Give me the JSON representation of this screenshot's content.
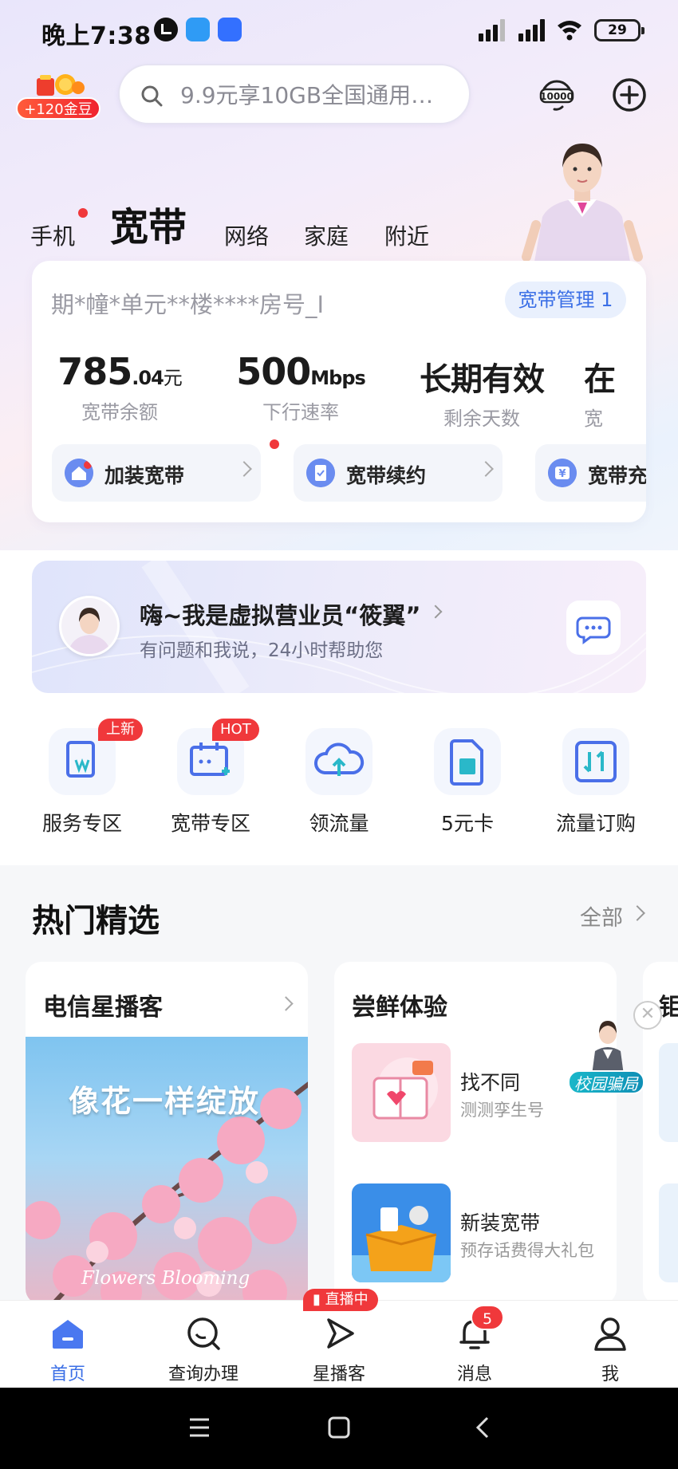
{
  "status_bar": {
    "time": "晚上7:38",
    "battery": "29",
    "icons": [
      "alarm-icon",
      "cloud-icon",
      "chat-app-icon",
      "signal-icon",
      "signal-icon",
      "wifi-icon",
      "battery-icon"
    ]
  },
  "header": {
    "coin_badge": "+120金豆",
    "search_placeholder": "9.9元享10GB全国通用…",
    "service_hotline_icon": "10000-hotline-icon",
    "add_icon": "plus-circle-icon"
  },
  "category_tabs": [
    {
      "label": "手机",
      "active": false,
      "dot": true
    },
    {
      "label": "宽带",
      "active": true,
      "dot": false
    },
    {
      "label": "网络",
      "active": false,
      "dot": false
    },
    {
      "label": "家庭",
      "active": false,
      "dot": false
    },
    {
      "label": "附近",
      "active": false,
      "dot": false
    }
  ],
  "broadband_card": {
    "address": "期*幢*单元**楼****房号_I",
    "manage_label": "宽带管理 1",
    "stats": [
      {
        "value": "785",
        "decimal": ".04",
        "unit": "元",
        "label": "宽带余额"
      },
      {
        "value": "500",
        "decimal": "",
        "unit": "Mbps",
        "label": "下行速率"
      },
      {
        "value": "长期有效",
        "decimal": "",
        "unit": "",
        "label": "剩余天数"
      },
      {
        "value": "在",
        "decimal": "",
        "unit": "",
        "label": "宽"
      }
    ],
    "actions": [
      {
        "label": "加装宽带",
        "icon": "home-add-icon"
      },
      {
        "label": "宽带续约",
        "icon": "contract-icon"
      },
      {
        "label": "宽带充",
        "icon": "yuan-icon"
      }
    ]
  },
  "assistant": {
    "title": "嗨~我是虚拟营业员“筱翼”",
    "subtitle": "有问题和我说，24小时帮助您"
  },
  "services": [
    {
      "label": "服务专区",
      "tag": "上新",
      "icon": "service-doc-icon"
    },
    {
      "label": "宽带专区",
      "tag": "HOT",
      "icon": "broadband-calendar-icon"
    },
    {
      "label": "领流量",
      "tag": "",
      "icon": "cloud-upload-icon"
    },
    {
      "label": "5元卡",
      "tag": "",
      "icon": "sim-card-icon"
    },
    {
      "label": "流量订购",
      "tag": "",
      "icon": "data-order-icon"
    }
  ],
  "featured": {
    "title": "热门精选",
    "more": "全部",
    "cards": [
      {
        "title": "电信星播客",
        "poster_title": "像花一样绽放",
        "poster_sub": "Flowers Blooming"
      },
      {
        "title": "尝鲜体验",
        "items": [
          {
            "name": "找不同",
            "desc": "测测孪生号"
          },
          {
            "name": "新装宽带",
            "desc": "预存话费得大礼包"
          }
        ]
      },
      {
        "title": "钜"
      }
    ],
    "float_promo": "校园骗局"
  },
  "bottom_nav": {
    "items": [
      {
        "label": "首页",
        "active": true
      },
      {
        "label": "查询办理",
        "active": false
      },
      {
        "label": "星播客",
        "active": false
      },
      {
        "label": "消息",
        "active": false
      },
      {
        "label": "我",
        "active": false
      }
    ],
    "live_tag": "直播中",
    "message_badge": "5"
  },
  "colors": {
    "brand_blue": "#3b6fe6",
    "alert_red": "#f0383b"
  }
}
